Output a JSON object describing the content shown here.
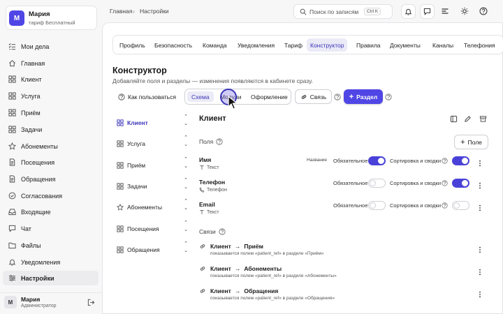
{
  "user": {
    "initial": "М",
    "name": "Мария",
    "plan": "тариф Бесплатный",
    "role": "Администратор"
  },
  "sidebar": {
    "items": [
      {
        "label": "Мои дела",
        "icon": "list-check-icon"
      },
      {
        "label": "Главная",
        "icon": "home-icon"
      },
      {
        "label": "Клиент",
        "icon": "table-icon"
      },
      {
        "label": "Услуга",
        "icon": "table-icon"
      },
      {
        "label": "Приём",
        "icon": "table-icon"
      },
      {
        "label": "Задачи",
        "icon": "table-icon"
      },
      {
        "label": "Абонементы",
        "icon": "star-icon"
      },
      {
        "label": "Посещения",
        "icon": "document-icon"
      },
      {
        "label": "Обращения",
        "icon": "document-icon"
      },
      {
        "label": "Согласования",
        "icon": "check-circle-icon"
      },
      {
        "label": "Входящие",
        "icon": "inbox-icon"
      },
      {
        "label": "Чат",
        "icon": "chat-icon"
      },
      {
        "label": "Файлы",
        "icon": "folder-icon"
      },
      {
        "label": "Уведомления",
        "icon": "bell-icon"
      },
      {
        "label": "Настройки",
        "icon": "sliders-icon",
        "active": true
      }
    ]
  },
  "breadcrumb": {
    "home": "Главная",
    "sep": "›",
    "current": "Настройки"
  },
  "search": {
    "placeholder": "Поиск по записям",
    "shortcut": "Ctrl K"
  },
  "tabs": [
    {
      "label": "Профиль"
    },
    {
      "label": "Безопасность"
    },
    {
      "label": "Команда"
    },
    {
      "label": "Уведомления"
    },
    {
      "label": "Тариф"
    },
    {
      "label": "Конструктор",
      "active": true
    },
    {
      "label": "Правила"
    },
    {
      "label": "Документы"
    },
    {
      "label": "Каналы"
    },
    {
      "label": "Телефония"
    }
  ],
  "page": {
    "title": "Конструктор",
    "subtitle": "Добавляйте поля и разделы — изменения появляются в кабинете сразу."
  },
  "toolbar": {
    "howto": "Как пользоваться",
    "segments": [
      {
        "label": "Схема",
        "active": true
      },
      {
        "label": "Модули"
      },
      {
        "label": "Оформление"
      }
    ],
    "link_button": "Связь",
    "add_section": "Раздел"
  },
  "sections": [
    {
      "label": "Клиент",
      "active": true
    },
    {
      "label": "Услуга"
    },
    {
      "label": "Приём"
    },
    {
      "label": "Задачи"
    },
    {
      "label": "Абонементы",
      "star": true
    },
    {
      "label": "Посещения"
    },
    {
      "label": "Обращения"
    }
  ],
  "detail": {
    "title": "Клиент",
    "fields_label": "Поля",
    "add_field": "Поле",
    "fields": [
      {
        "name": "Имя",
        "type": "Текст",
        "badge": "Название",
        "required_label": "Обязательное",
        "required": true,
        "sort_label": "Сортировка и сводки",
        "sort": true
      },
      {
        "name": "Телефон",
        "type": "Телефон",
        "badge": "",
        "required_label": "Обязательное",
        "required": false,
        "sort_label": "Сортировка и сводки",
        "sort": true
      },
      {
        "name": "Email",
        "type": "Текст",
        "badge": "",
        "required_label": "Обязательное",
        "required": false,
        "sort_label": "Сортировка и сводки",
        "sort": false
      }
    ],
    "links_label": "Связи",
    "links": [
      {
        "from": "Клиент",
        "arrow": "→",
        "to": "Приём",
        "desc": "показывается полем «patient_ref» в разделе «Приём»"
      },
      {
        "from": "Клиент",
        "arrow": "→",
        "to": "Абонементы",
        "desc": "показывается полем «patient_ref» в разделе «Абонементы»"
      },
      {
        "from": "Клиент",
        "arrow": "→",
        "to": "Обращения",
        "desc": "показывается полем «patient_ref» в разделе «Обращения»"
      }
    ]
  },
  "colors": {
    "accent": "#5046e5",
    "accent_light": "#ebeaf7",
    "accent_text": "#3b36b8"
  }
}
